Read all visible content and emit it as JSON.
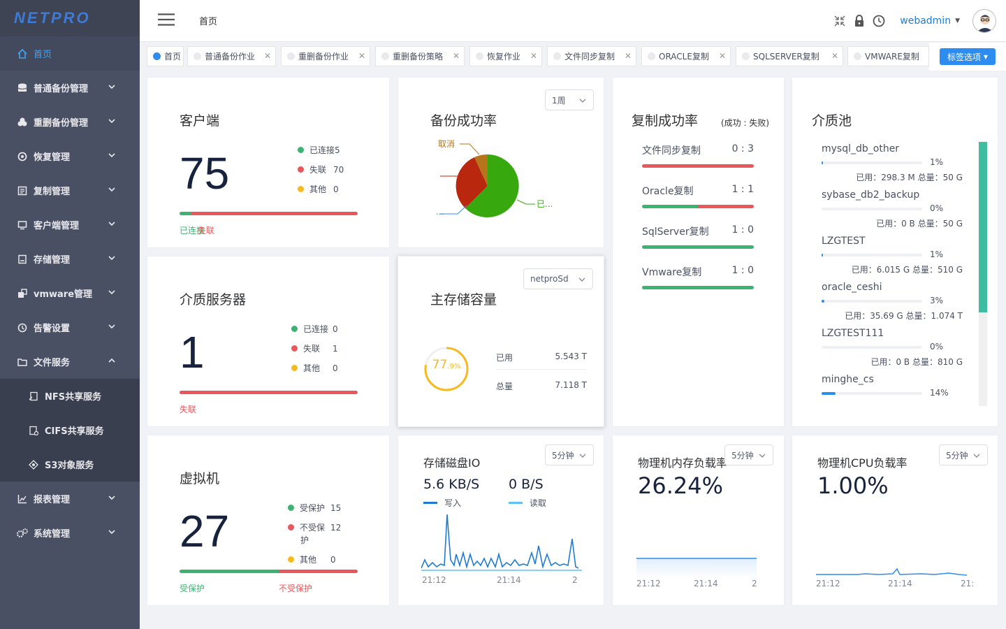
{
  "logo": "NETPRO",
  "sidebar": {
    "items": [
      {
        "label": "首页",
        "icon": "home-icon"
      },
      {
        "label": "普通备份管理",
        "icon": "database-icon"
      },
      {
        "label": "重删备份管理",
        "icon": "dedup-icon"
      },
      {
        "label": "恢复管理",
        "icon": "restore-icon"
      },
      {
        "label": "复制管理",
        "icon": "copy-icon"
      },
      {
        "label": "客户端管理",
        "icon": "client-icon"
      },
      {
        "label": "存储管理",
        "icon": "storage-icon"
      },
      {
        "label": "vmware管理",
        "icon": "vmware-icon"
      },
      {
        "label": "告警设置",
        "icon": "alarm-icon"
      },
      {
        "label": "文件服务",
        "icon": "folder-icon"
      }
    ],
    "sub_items": [
      {
        "label": "NFS共享服务",
        "icon": "nfs-icon"
      },
      {
        "label": "CIFS共享服务",
        "icon": "cifs-icon"
      },
      {
        "label": "S3对象服务",
        "icon": "s3-icon"
      }
    ],
    "bottom_items": [
      {
        "label": "报表管理",
        "icon": "report-icon"
      },
      {
        "label": "系统管理",
        "icon": "settings-icon"
      }
    ]
  },
  "header": {
    "breadcrumb": "首页",
    "username": "webadmin"
  },
  "tabs": [
    "首页",
    "普通备份作业",
    "重删备份作业",
    "重删备份策略",
    "恢复作业",
    "文件同步复制",
    "ORACLE复制",
    "SQLSERVER复制",
    "VMWARE复制"
  ],
  "tag_options": "标签选项",
  "client_card": {
    "title": "客户端",
    "total": "75",
    "legend": [
      {
        "label": "已连接",
        "value": "5"
      },
      {
        "label": "失联",
        "value": "70"
      },
      {
        "label": "其他",
        "value": "0"
      }
    ],
    "connected_fraction": 0.067,
    "bar_labels": {
      "left": "已连接",
      "right": "失联"
    }
  },
  "backup_rate_card": {
    "title": "备份成功率",
    "period": "1周",
    "pie_labels": {
      "cancel": "取消",
      "success": "已...",
      "other": "..."
    }
  },
  "replication_card": {
    "title": "复制成功率",
    "subtitle": "(成功 : 失败)",
    "rows": [
      {
        "label": "文件同步复制",
        "ratio": "0 : 3",
        "success_fraction": 0
      },
      {
        "label": "Oracle复制",
        "ratio": "1 : 1",
        "success_fraction": 0.5
      },
      {
        "label": "SqlServer复制",
        "ratio": "1 : 0",
        "success_fraction": 1
      },
      {
        "label": "Vmware复制",
        "ratio": "1 : 0",
        "success_fraction": 1
      }
    ]
  },
  "media_card": {
    "title": "介质池",
    "items": [
      {
        "name": "mysql_db_other",
        "pct": "1%",
        "fraction": 0.01,
        "used": "已用：298.3 M 总量：50 G"
      },
      {
        "name": "sybase_db2_backup",
        "pct": "0%",
        "fraction": 0,
        "used": "已用：0 B 总量：50 G"
      },
      {
        "name": "LZGTEST",
        "pct": "1%",
        "fraction": 0.01,
        "used": "已用：6.015 G 总量：510 G"
      },
      {
        "name": "oracle_ceshi",
        "pct": "3%",
        "fraction": 0.03,
        "used": "已用：35.69 G 总量：1.074 T"
      },
      {
        "name": "LZGTEST111",
        "pct": "0%",
        "fraction": 0,
        "used": "已用：0 B 总量：810 G"
      },
      {
        "name": "minghe_cs",
        "pct": "14%",
        "fraction": 0.14,
        "used": ""
      }
    ]
  },
  "media_server_card": {
    "title": "介质服务器",
    "total": "1",
    "legend": [
      {
        "label": "已连接",
        "value": "0"
      },
      {
        "label": "失联",
        "value": "1"
      },
      {
        "label": "其他",
        "value": "0"
      }
    ],
    "bar_label": "失联"
  },
  "storage_card": {
    "title": "主存储容量",
    "select": "netproSd",
    "gauge_main": "77",
    "gauge_dec": ".9%",
    "gauge_fraction": 0.779,
    "rows": [
      {
        "label": "已用",
        "value": "5.543 T"
      },
      {
        "label": "总量",
        "value": "7.118 T"
      }
    ]
  },
  "vm_card": {
    "title": "虚拟机",
    "total": "27",
    "legend": [
      {
        "label": "受保护",
        "value": "15"
      },
      {
        "label": "不受保",
        "value": "12"
      },
      {
        "label": "其他",
        "value": "0"
      }
    ],
    "legend_wrap": "护",
    "protected_fraction": 0.556,
    "bar_labels": {
      "left": "受保护",
      "right": "不受保护"
    }
  },
  "disk_io_card": {
    "title": "存储磁盘IO",
    "period": "5分钟",
    "write": {
      "value": "5.6 KB/S",
      "label": "写入"
    },
    "read": {
      "value": "0 B/S",
      "label": "读取"
    },
    "x_labels": [
      "21:12",
      "21:14",
      "2"
    ]
  },
  "mem_card": {
    "title": "物理机内存负载率",
    "period": "5分钟",
    "value": "26.24%",
    "x_labels": [
      "21:12",
      "21:14",
      "2"
    ]
  },
  "cpu_card": {
    "title": "物理机CPU负载率",
    "period": "5分钟",
    "value": "1.00%",
    "x_labels": [
      "21:12",
      "21:14",
      "21:"
    ]
  },
  "colors": {
    "green": "#3cb371",
    "red": "#e9575b",
    "yellow": "#f7ba1e",
    "blue": "#2d8cf0",
    "teal": "#3ebda0"
  }
}
